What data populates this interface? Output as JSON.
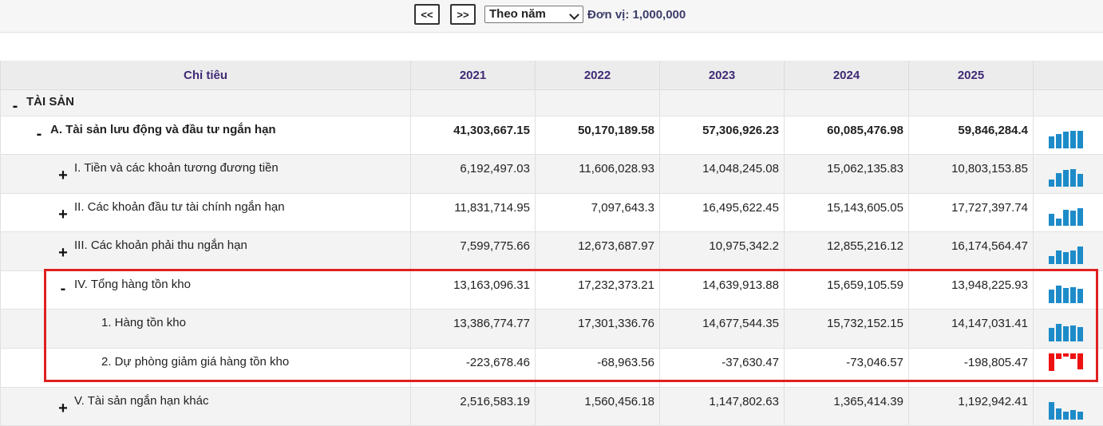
{
  "toolbar": {
    "prev_label": "<<",
    "next_label": ">>",
    "period_value": "Theo năm",
    "unit_label": "Đơn vị: 1,000,000"
  },
  "table": {
    "header": {
      "indicator": "Chỉ tiêu",
      "years": [
        "2021",
        "2022",
        "2023",
        "2024",
        "2025"
      ]
    },
    "rows": [
      {
        "toggle": "-",
        "label": "TÀI SẢN",
        "values": [
          "",
          "",
          "",
          "",
          ""
        ]
      },
      {
        "toggle": "-",
        "label": "A. Tài sản lưu động và đầu tư ngắn hạn",
        "values": [
          "41,303,667.15",
          "50,170,189.58",
          "57,306,926.23",
          "60,085,476.98",
          "59,846,284.4"
        ],
        "spark": [
          41303667.15,
          50170189.58,
          57306926.23,
          60085476.98,
          59846284.4
        ]
      },
      {
        "toggle": "+",
        "label": "I. Tiền và các khoản tương đương tiền",
        "values": [
          "6,192,497.03",
          "11,606,028.93",
          "14,048,245.08",
          "15,062,135.83",
          "10,803,153.85"
        ],
        "spark": [
          6192497.03,
          11606028.93,
          14048245.08,
          15062135.83,
          10803153.85
        ]
      },
      {
        "toggle": "+",
        "label": "II. Các khoản đầu tư tài chính ngắn hạn",
        "values": [
          "11,831,714.95",
          "7,097,643.3",
          "16,495,622.45",
          "15,143,605.05",
          "17,727,397.74"
        ],
        "spark": [
          11831714.95,
          7097643.3,
          16495622.45,
          15143605.05,
          17727397.74
        ]
      },
      {
        "toggle": "+",
        "label": "III. Các khoản phải thu ngắn hạn",
        "values": [
          "7,599,775.66",
          "12,673,687.97",
          "10,975,342.2",
          "12,855,216.12",
          "16,174,564.47"
        ],
        "spark": [
          7599775.66,
          12673687.97,
          10975342.2,
          12855216.12,
          16174564.47
        ]
      },
      {
        "toggle": "-",
        "label": "IV. Tổng hàng tồn kho",
        "values": [
          "13,163,096.31",
          "17,232,373.21",
          "14,639,913.88",
          "15,659,105.59",
          "13,948,225.93"
        ],
        "spark": [
          13163096.31,
          17232373.21,
          14639913.88,
          15659105.59,
          13948225.93
        ]
      },
      {
        "toggle": "",
        "label": "1. Hàng tồn kho",
        "values": [
          "13,386,774.77",
          "17,301,336.76",
          "14,677,544.35",
          "15,732,152.15",
          "14,147,031.41"
        ],
        "spark": [
          13386774.77,
          17301336.76,
          14677544.35,
          15732152.15,
          14147031.41
        ]
      },
      {
        "toggle": "",
        "label": "2. Dự phòng giảm giá hàng tồn kho",
        "values": [
          "-223,678.46",
          "-68,963.56",
          "-37,630.47",
          "-73,046.57",
          "-198,805.47"
        ],
        "spark": [
          -223678.46,
          -68963.56,
          -37630.47,
          -73046.57,
          -198805.47
        ]
      },
      {
        "toggle": "+",
        "label": "V. Tài sản ngắn hạn khác",
        "values": [
          "2,516,583.19",
          "1,560,456.18",
          "1,147,802.63",
          "1,365,414.39",
          "1,192,942.41"
        ],
        "spark": [
          2516583.19,
          1560456.18,
          1147802.63,
          1365414.39,
          1192942.41
        ]
      }
    ]
  },
  "colors": {
    "header_text": "#3f2a75",
    "spark_positive": "#1e8bc9",
    "spark_negative": "#ee1111",
    "highlight_border": "#e02020"
  }
}
